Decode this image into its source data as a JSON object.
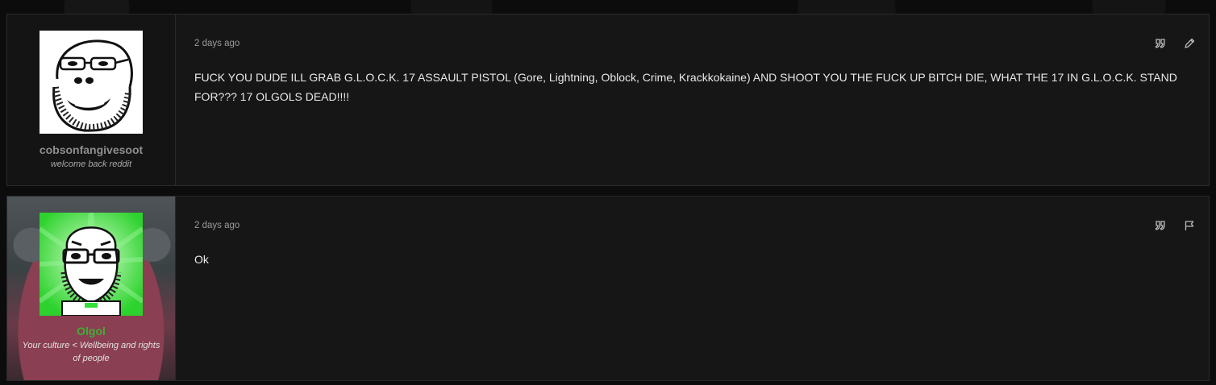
{
  "posts": [
    {
      "username": "cobsonfangivesoot",
      "user_title": "welcome back reddit",
      "date": "2 days ago",
      "body": "FUCK YOU DUDE ILL GRAB G.L.O.C.K. 17 ASSAULT PISTOL (Gore, Lightning, Oblock, Crime, Krackkokaine) AND SHOOT YOU THE FUCK UP BITCH DIE, WHAT THE 17 IN G.L.O.C.K. STAND FOR??? 17 OLGOLS DEAD!!!!",
      "actions": [
        "quote-icon",
        "edit-icon"
      ],
      "username_color": "#8e8e8e"
    },
    {
      "username": "Olgol",
      "user_title": "Your culture < Wellbeing and rights of people",
      "date": "2 days ago",
      "body": "Ok",
      "actions": [
        "quote-icon",
        "report-flag-icon"
      ],
      "username_color": "#3fae33"
    }
  ],
  "colors": {
    "background": "#0c0c0c",
    "post_background": "#161616",
    "text": "#e8e8e8",
    "muted": "#9a9a9a"
  }
}
